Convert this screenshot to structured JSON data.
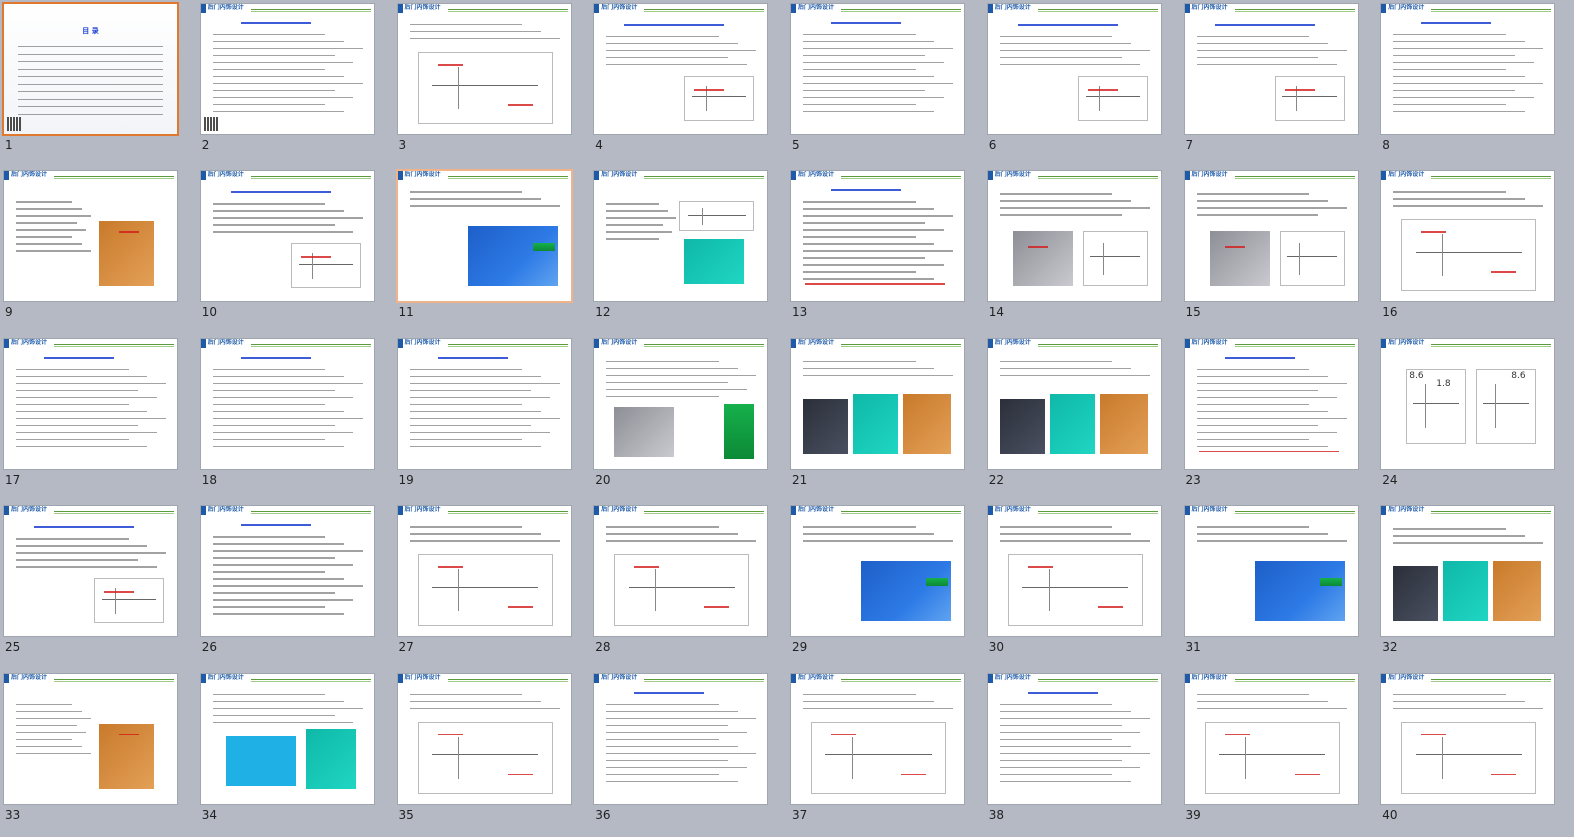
{
  "window": {
    "width": 1574,
    "height": 837
  },
  "colors": {
    "background": "#b4b9c3",
    "slide": "#ffffff",
    "selection": "#e0782e",
    "header_text": "#1e5aa8",
    "header_rule": "#5a9b3c",
    "title_blue": "#1c3fd1",
    "annotation_red": "#d21c1c"
  },
  "selected_slide": 1,
  "hovered_slide": 11,
  "slides": [
    {
      "number": "1",
      "header": "",
      "kind": "toc",
      "toc_title": "目  录"
    },
    {
      "number": "2",
      "header": "后门内饰设计",
      "kind": "text"
    },
    {
      "number": "3",
      "header": "后门内饰设计",
      "kind": "drawing"
    },
    {
      "number": "4",
      "header": "后门内饰设计",
      "kind": "text-fig"
    },
    {
      "number": "5",
      "header": "后门内饰设计",
      "kind": "text"
    },
    {
      "number": "6",
      "header": "后门内饰设计",
      "kind": "text-fig"
    },
    {
      "number": "7",
      "header": "后门内饰设计",
      "kind": "text-fig"
    },
    {
      "number": "8",
      "header": "后门内饰设计",
      "kind": "text"
    },
    {
      "number": "9",
      "header": "后门内饰设计",
      "kind": "brown-fig"
    },
    {
      "number": "10",
      "header": "后门内饰设计",
      "kind": "text-fig"
    },
    {
      "number": "11",
      "header": "后门内饰设计",
      "kind": "blue-fig"
    },
    {
      "number": "12",
      "header": "后门内饰设计",
      "kind": "teal-fig"
    },
    {
      "number": "13",
      "header": "后门内饰设计",
      "kind": "text"
    },
    {
      "number": "14",
      "header": "后门内饰设计",
      "kind": "gray-fig"
    },
    {
      "number": "15",
      "header": "后门内饰设计",
      "kind": "gray-fig"
    },
    {
      "number": "16",
      "header": "后门内饰设计",
      "kind": "drawing"
    },
    {
      "number": "17",
      "header": "后门内饰设计",
      "kind": "text"
    },
    {
      "number": "18",
      "header": "后门内饰设计",
      "kind": "text"
    },
    {
      "number": "19",
      "header": "后门内饰设计",
      "kind": "text"
    },
    {
      "number": "20",
      "header": "后门内饰设计",
      "kind": "green-fig"
    },
    {
      "number": "21",
      "header": "后门内饰设计",
      "kind": "multi-fig"
    },
    {
      "number": "22",
      "header": "后门内饰设计",
      "kind": "multi-fig"
    },
    {
      "number": "23",
      "header": "后门内饰设计",
      "kind": "text"
    },
    {
      "number": "24",
      "header": "后门内饰设计",
      "kind": "dims",
      "dim_a": "8.6",
      "dim_b": "1.8",
      "dim_c": "8.6"
    },
    {
      "number": "25",
      "header": "后门内饰设计",
      "kind": "text-fig"
    },
    {
      "number": "26",
      "header": "后门内饰设计",
      "kind": "text"
    },
    {
      "number": "27",
      "header": "后门内饰设计",
      "kind": "drawing"
    },
    {
      "number": "28",
      "header": "后门内饰设计",
      "kind": "drawing"
    },
    {
      "number": "29",
      "header": "后门内饰设计",
      "kind": "blue-fig"
    },
    {
      "number": "30",
      "header": "后门内饰设计",
      "kind": "drawing"
    },
    {
      "number": "31",
      "header": "后门内饰设计",
      "kind": "blue-fig"
    },
    {
      "number": "32",
      "header": "后门内饰设计",
      "kind": "multi-fig"
    },
    {
      "number": "33",
      "header": "后门内饰设计",
      "kind": "brown-fig"
    },
    {
      "number": "34",
      "header": "后门内饰设计",
      "kind": "cyan-fig"
    },
    {
      "number": "35",
      "header": "后门内饰设计",
      "kind": "drawing"
    },
    {
      "number": "36",
      "header": "后门内饰设计",
      "kind": "text"
    },
    {
      "number": "37",
      "header": "后门内饰设计",
      "kind": "drawing"
    },
    {
      "number": "38",
      "header": "后门内饰设计",
      "kind": "text"
    },
    {
      "number": "39",
      "header": "后门内饰设计",
      "kind": "drawing"
    },
    {
      "number": "40",
      "header": "后门内饰设计",
      "kind": "drawing"
    }
  ]
}
